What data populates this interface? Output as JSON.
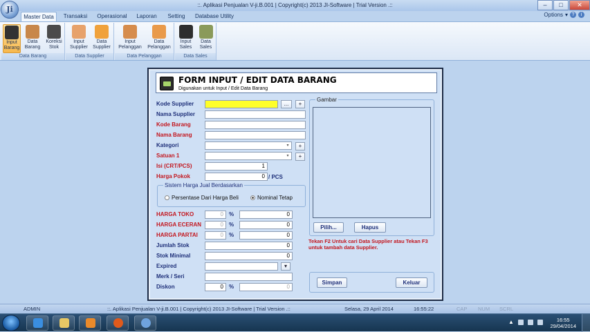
{
  "window": {
    "title": "::. Aplikasi Penjualan V-ji.B.001  |  Copyright(c) 2013 JI-Software  |  Trial Version  .::",
    "orb_label": "Ji"
  },
  "ribbon": {
    "tabs": [
      {
        "label": "Master Data",
        "active": true
      },
      {
        "label": "Transaksi"
      },
      {
        "label": "Operasional"
      },
      {
        "label": "Laporan"
      },
      {
        "label": "Setting"
      },
      {
        "label": "Database Utility"
      }
    ],
    "options_label": "Options",
    "groups": [
      {
        "label": "Data Barang",
        "buttons": [
          {
            "line1": "Input",
            "line2": "Barang",
            "icon": "cash-register-icon",
            "active": true
          },
          {
            "line1": "Data",
            "line2": "Barang",
            "icon": "box-icon"
          },
          {
            "line1": "Koreksi",
            "line2": "Stok",
            "icon": "worker-icon"
          }
        ]
      },
      {
        "label": "Data Supplier",
        "buttons": [
          {
            "line1": "Input",
            "line2": "Supplier",
            "icon": "add-person-icon"
          },
          {
            "line1": "Data",
            "line2": "Supplier",
            "icon": "basket-icon"
          }
        ]
      },
      {
        "label": "Data Pelanggan",
        "buttons": [
          {
            "line1": "Input",
            "line2": "Pelanggan",
            "icon": "add-customer-icon"
          },
          {
            "line1": "Data",
            "line2": "Pelanggan",
            "icon": "customer-icon"
          }
        ]
      },
      {
        "label": "Data Sales",
        "buttons": [
          {
            "line1": "Input",
            "line2": "Sales",
            "icon": "salesman-icon"
          },
          {
            "line1": "Data",
            "line2": "Sales",
            "icon": "sales-group-icon"
          }
        ]
      }
    ]
  },
  "form": {
    "title": "FORM INPUT / EDIT DATA BARANG",
    "subtitle": "Digunakan untuk Input / Edit Data Barang",
    "labels": {
      "kode_supplier": "Kode Supplier",
      "nama_supplier": "Nama Supplier",
      "kode_barang": "Kode Barang",
      "nama_barang": "Nama Barang",
      "kategori": "Kategori",
      "satuan": "Satuan 1",
      "isi": "Isi (CRT/PCS)",
      "harga_pokok": "Harga Pokok",
      "harga_toko": "HARGA TOKO",
      "harga_eceran": "HARGA ECERAN",
      "harga_partai": "HARGA PARTAI",
      "jumlah_stok": "Jumlah Stok",
      "stok_minimal": "Stok Minimal",
      "expired": "Expired",
      "merk": "Merk / Seri",
      "diskon": "Diskon"
    },
    "values": {
      "isi": "1",
      "harga_pokok": "0",
      "harga_toko_pct": "0",
      "harga_toko": "0",
      "harga_eceran_pct": "0",
      "harga_eceran": "0",
      "harga_partai_pct": "0",
      "harga_partai": "0",
      "jumlah_stok": "0",
      "stok_minimal": "0",
      "diskon_pct": "0",
      "diskon": "0"
    },
    "pcs_label": "/ PCS",
    "pct_symbol": "%",
    "browse_label": "...",
    "plus_label": "+",
    "sistem": {
      "legend": "Sistem Harga Jual Berdasarkan",
      "option1": "Persentase Dari Harga Beli",
      "option2": "Nominal Tetap",
      "selected": "option2"
    },
    "gambar": {
      "legend": "Gambar",
      "pilih": "Pilih...",
      "hapus": "Hapus"
    },
    "hint": "Tekan F2 Untuk cari Data Supplier atau Tekan F3 untuk tambah data Supplier.",
    "simpan": "Simpan",
    "keluar": "Keluar"
  },
  "statusbar": {
    "user": "ADMIN",
    "app": "::. Aplikasi Penjualan V-ji.B.001  |  Copyright(c) 2013 JI-Software  |  Trial Version  .::",
    "date": "Selasa, 29 April 2014",
    "time": "16:55:22",
    "cap": "CAP",
    "num": "NUM",
    "scrl": "SCRL"
  },
  "taskbar": {
    "clock_time": "16:55",
    "clock_date": "29/04/2014"
  }
}
